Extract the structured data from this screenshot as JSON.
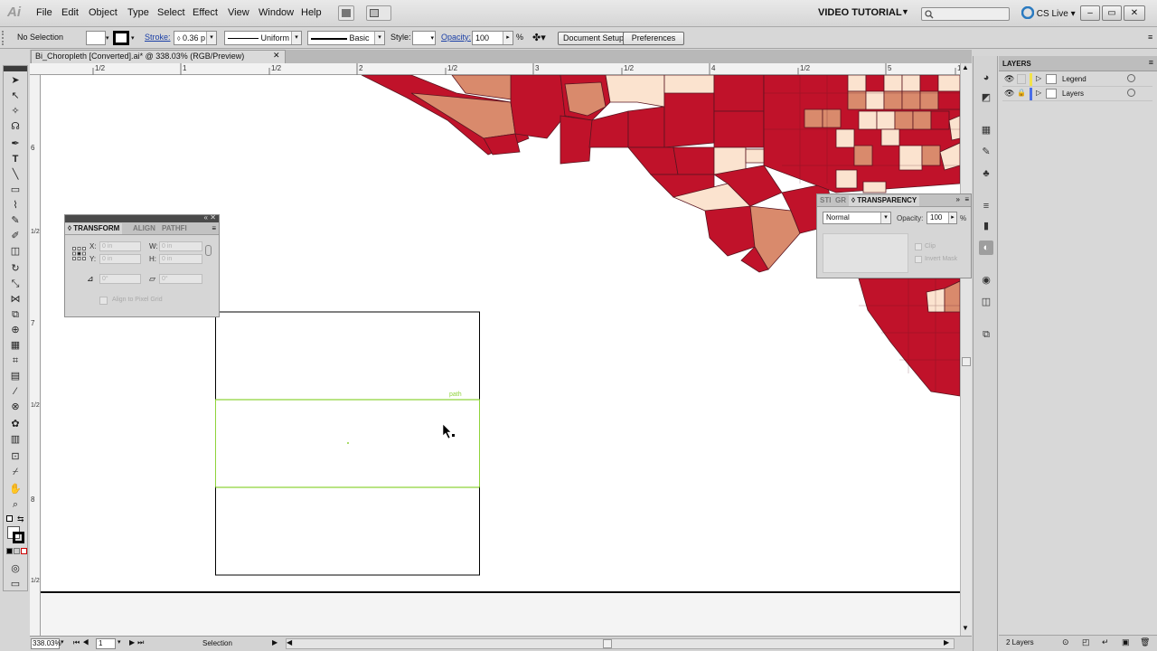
{
  "menubar": {
    "app_icon": "Ai",
    "items": [
      "File",
      "Edit",
      "Object",
      "Type",
      "Select",
      "Effect",
      "View",
      "Window",
      "Help"
    ],
    "workspace": "VIDEO TUTORIAL",
    "cs_live": "CS Live"
  },
  "controlbar": {
    "selection_state": "No Selection",
    "stroke_label": "Stroke:",
    "stroke_weight": "0.36 p",
    "stroke_profile": "Uniform",
    "brush": "Basic",
    "style_label": "Style:",
    "opacity_label": "Opacity:",
    "opacity_value": "100",
    "opacity_unit": "%",
    "document_setup": "Document Setup",
    "preferences": "Preferences"
  },
  "document": {
    "tab_title": "Bi_Choropleth [Converted].ai* @ 338.03% (RGB/Preview)",
    "close_glyph": "✕"
  },
  "ruler": {
    "h_ticks": [
      "1/2",
      "1",
      "1/2",
      "2",
      "1/2",
      "3",
      "1/2",
      "4",
      "1/2",
      "5",
      "1/2"
    ],
    "v_ticks": [
      "6",
      "1/2",
      "7",
      "1/2",
      "8",
      "1/2"
    ]
  },
  "canvas": {
    "hover_label": "path"
  },
  "transform_panel": {
    "tabs": [
      "TRANSFORM",
      "ALIGN",
      "PATHFI"
    ],
    "x_label": "X:",
    "y_label": "Y:",
    "w_label": "W:",
    "h_label": "H:",
    "x_value": "0 in",
    "y_value": "0 in",
    "w_value": "0 in",
    "h_value": "0 in",
    "rotate_value": "0°",
    "shear_value": "0°",
    "align_pixel_grid": "Align to Pixel Grid"
  },
  "transparency_panel": {
    "tabs": [
      "STI",
      "GR",
      "TRANSPARENCY"
    ],
    "blend_mode": "Normal",
    "opacity_label": "Opacity:",
    "opacity_value": "100",
    "opacity_unit": "%",
    "clip_label": "Clip",
    "invert_mask_label": "Invert Mask"
  },
  "layers_panel": {
    "title": "LAYERS",
    "layers": [
      {
        "name": "Legend",
        "color": "#f3e34a"
      },
      {
        "name": "Layers",
        "color": "#4a6ee8"
      }
    ],
    "count_label": "2 Layers"
  },
  "statusbar": {
    "zoom": "338.03%",
    "artboard": "1",
    "tool": "Selection"
  },
  "colors": {
    "dark_red": "#c0122a",
    "salmon": "#d98a6c",
    "pale": "#fbe3cf",
    "selection_green": "#8fd33b"
  }
}
